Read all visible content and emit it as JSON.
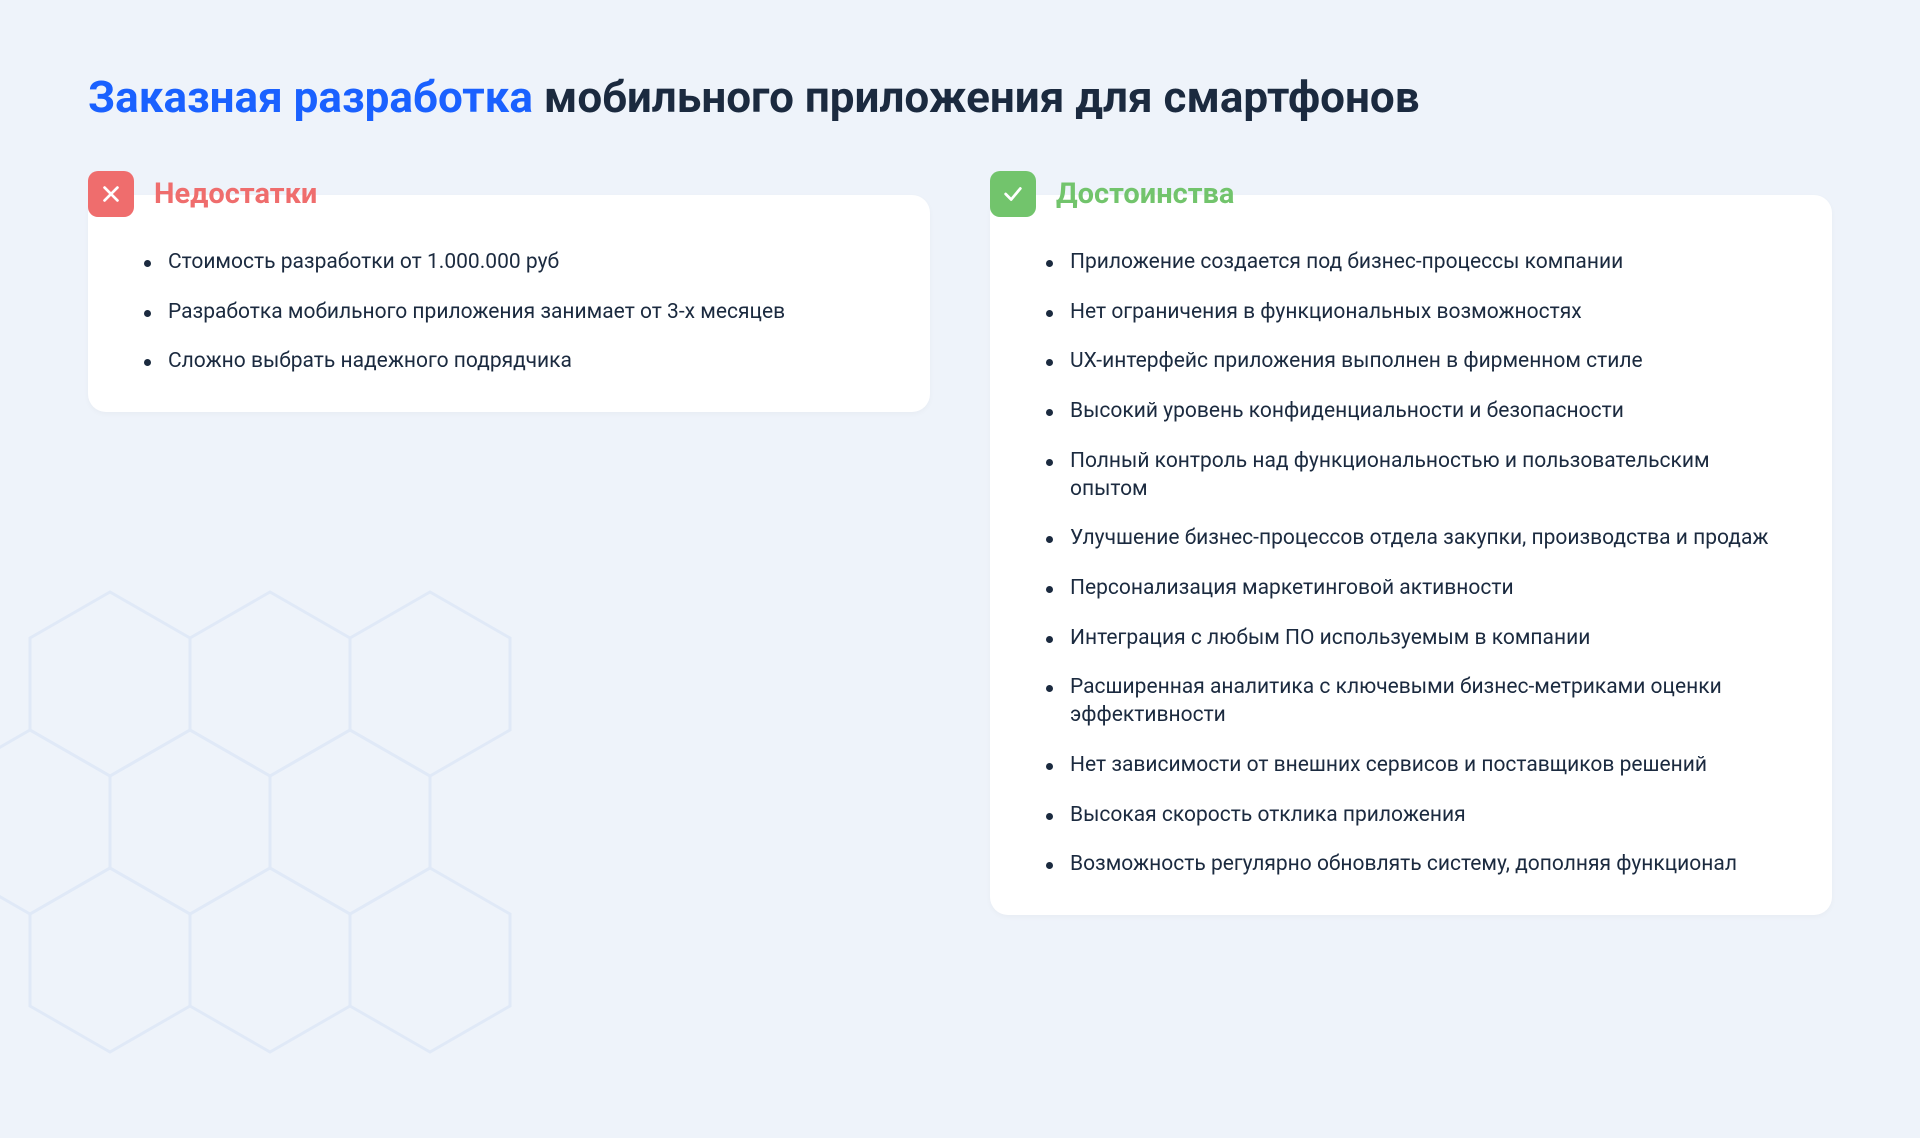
{
  "title": {
    "accent": "Заказная разработка",
    "rest": " мобильного приложения для смартфонов"
  },
  "cons": {
    "heading": "Недостатки",
    "items": [
      "Стоимость разработки от 1.000.000 руб",
      "Разработка мобильного приложения занимает от 3-х месяцев",
      "Сложно выбрать надежного подрядчика"
    ]
  },
  "pros": {
    "heading": "Достоинства",
    "items": [
      "Приложение создается под бизнес-процессы компании",
      "Нет ограничения в функциональных возможностях",
      "UX-интерфейс приложения выполнен в фирменном стиле",
      "Высокий уровень конфиденциальности и безопасности",
      "Полный контроль над функциональностью и пользовательским опытом",
      "Улучшение бизнес-процессов отдела закупки, производства и продаж",
      "Персонализация маркетинговой активности",
      "Интеграция с любым ПО используемым в компании",
      "Расширенная аналитика с ключевыми бизнес-метриками оценки эффективности",
      "Нет зависимости от внешних сервисов и поставщиков решений",
      "Высокая скорость отклика приложения",
      "Возможность регулярно обновлять систему, дополняя функционал"
    ]
  }
}
